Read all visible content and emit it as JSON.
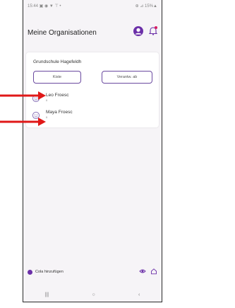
{
  "status_bar": {
    "left": "15:44 ▣ ◉ ▼ ⊤ •",
    "right": "⊕ ⊿ 15%▲"
  },
  "header": {
    "title": "Meine Organisationen"
  },
  "organization": {
    "name": "Grundschule Hagefeldh",
    "button_left": "Kiste",
    "button_right": "Verantw. ab"
  },
  "members": [
    {
      "name": "Leo Froesc",
      "sub": "x"
    },
    {
      "name": "Maya Froesc",
      "sub": "x"
    }
  ],
  "footer": {
    "add_label": "Cola hinzufügen"
  },
  "nav": {
    "recent": "|||",
    "home": "○",
    "back": "‹"
  },
  "colors": {
    "accent": "#6b2fa8",
    "button_border": "#6b4aa0",
    "arrow": "#e01818",
    "bell": "#d81b60"
  }
}
